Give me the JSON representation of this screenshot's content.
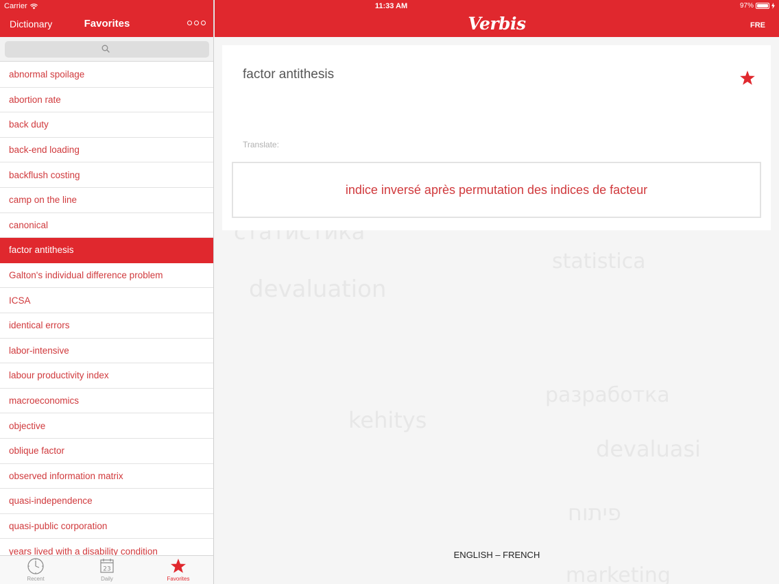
{
  "status": {
    "carrier": "Carrier",
    "time": "11:33 AM",
    "battery": "97%"
  },
  "left_header": {
    "dictionary_label": "Dictionary",
    "title": "Favorites",
    "more_icon": "more-dots-icon"
  },
  "search": {
    "placeholder": "",
    "value": ""
  },
  "favorites": [
    "abnormal spoilage",
    "abortion rate",
    "back duty",
    "back-end loading",
    "backflush costing",
    "camp on the line",
    "canonical",
    "factor antithesis",
    "Galton's individual difference problem",
    "ICSA",
    "identical errors",
    "labor-intensive",
    "labour productivity index",
    "macroeconomics",
    "objective",
    "oblique factor",
    "observed information matrix",
    "quasi-independence",
    "quasi-public corporation",
    "years lived with a disability condition"
  ],
  "selected_index": 7,
  "tabs": [
    {
      "label": "Recent",
      "icon": "clock-icon"
    },
    {
      "label": "Daily",
      "icon": "calendar-icon",
      "day": "23"
    },
    {
      "label": "Favorites",
      "icon": "star-icon"
    }
  ],
  "right_header": {
    "brand": "Verbis",
    "language_button": "FRE"
  },
  "card": {
    "word": "factor antithesis",
    "translate_label": "Translate:",
    "translation": "indice inversé après permutation des indices de facteur",
    "favorite_icon": "star-icon"
  },
  "language_pair": "ENGLISH – FRENCH",
  "background_words": [
    "статистика",
    "statistica",
    "devaluation",
    "kehitys",
    "разработка",
    "devaluasi",
    "פיתוח",
    "marketing"
  ],
  "colors": {
    "accent": "#e0282e",
    "list_text": "#d0393c"
  }
}
